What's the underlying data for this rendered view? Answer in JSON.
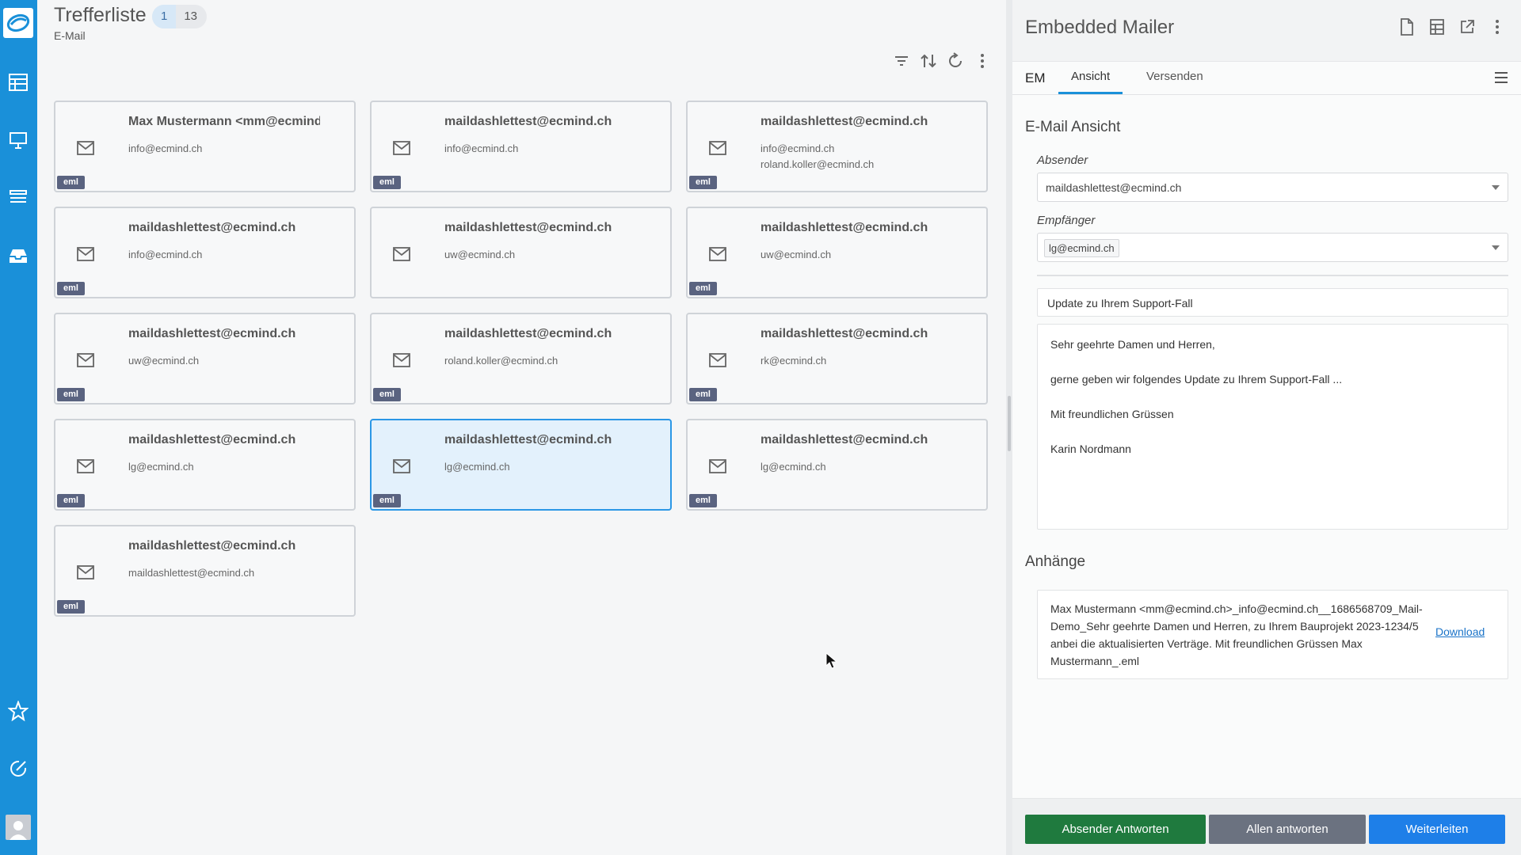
{
  "results": {
    "title": "Trefferliste",
    "badge_page": "1",
    "badge_total": "13",
    "subtitle": "E-Mail",
    "cards": [
      {
        "sender": "Max Mustermann <mm@ecmind.ch>",
        "recipients": "info@ecmind.ch",
        "tag": "eml"
      },
      {
        "sender": "maildashlettest@ecmind.ch",
        "recipients": "info@ecmind.ch",
        "tag": "eml"
      },
      {
        "sender": "maildashlettest@ecmind.ch",
        "recipients": "info@ecmind.ch",
        "recipients2": "roland.koller@ecmind.ch",
        "tag": "eml"
      },
      {
        "sender": "maildashlettest@ecmind.ch",
        "recipients": "info@ecmind.ch",
        "tag": "eml"
      },
      {
        "sender": "maildashlettest@ecmind.ch",
        "recipients": "uw@ecmind.ch",
        "tag": "eml"
      },
      {
        "sender": "maildashlettest@ecmind.ch",
        "recipients": "uw@ecmind.ch",
        "tag": "eml"
      },
      {
        "sender": "maildashlettest@ecmind.ch",
        "recipients": "uw@ecmind.ch",
        "tag": "eml"
      },
      {
        "sender": "maildashlettest@ecmind.ch",
        "recipients": "roland.koller@ecmind.ch",
        "tag": "eml"
      },
      {
        "sender": "maildashlettest@ecmind.ch",
        "recipients": "rk@ecmind.ch",
        "tag": "eml"
      },
      {
        "sender": "maildashlettest@ecmind.ch",
        "recipients": "lg@ecmind.ch",
        "tag": "eml"
      },
      {
        "sender": "maildashlettest@ecmind.ch",
        "recipients": "lg@ecmind.ch",
        "tag": "eml"
      },
      {
        "sender": "maildashlettest@ecmind.ch",
        "recipients": "lg@ecmind.ch",
        "tag": "eml"
      },
      {
        "sender": "maildashlettest@ecmind.ch",
        "recipients": "maildashlettest@ecmind.ch",
        "tag": "eml"
      }
    ]
  },
  "mailer": {
    "title": "Embedded Mailer",
    "tab_em": "EM",
    "tabs": [
      "Ansicht",
      "Versenden"
    ],
    "section_view": "E-Mail Ansicht",
    "sender_label": "Absender",
    "sender_value": "maildashlettest@ecmind.ch",
    "recipient_label": "Empfänger",
    "recipient_value": "lg@ecmind.ch",
    "subject": "Update zu Ihrem Support-Fall",
    "body": [
      "Sehr geehrte Damen und Herren,",
      "gerne geben wir folgendes Update zu Ihrem Support-Fall ...",
      "Mit freundlichen Grüssen",
      "Karin Nordmann"
    ],
    "attachments_title": "Anhänge",
    "attachment_name": "Max Mustermann <mm@ecmind.ch>_info@ecmind.ch__1686568709_Mail-Demo_Sehr geehrte Damen und Herren, zu Ihrem Bauprojekt 2023-1234/5 anbei die aktualisierten Verträge. Mit freundlichen Grüssen Max Mustermann_.eml",
    "download_label": "Download",
    "buttons": {
      "reply_sender": "Absender Antworten",
      "reply_all": "Allen antworten",
      "forward": "Weiterleiten"
    }
  },
  "colors": {
    "rail": "#1a90d9",
    "selected_border": "#2b97e6",
    "selected_bg": "#e3f1fc",
    "eml_tag": "#5a6380",
    "btn_green": "#1f7a3e",
    "btn_grey": "#6b7280",
    "btn_blue": "#1e7fe8"
  }
}
